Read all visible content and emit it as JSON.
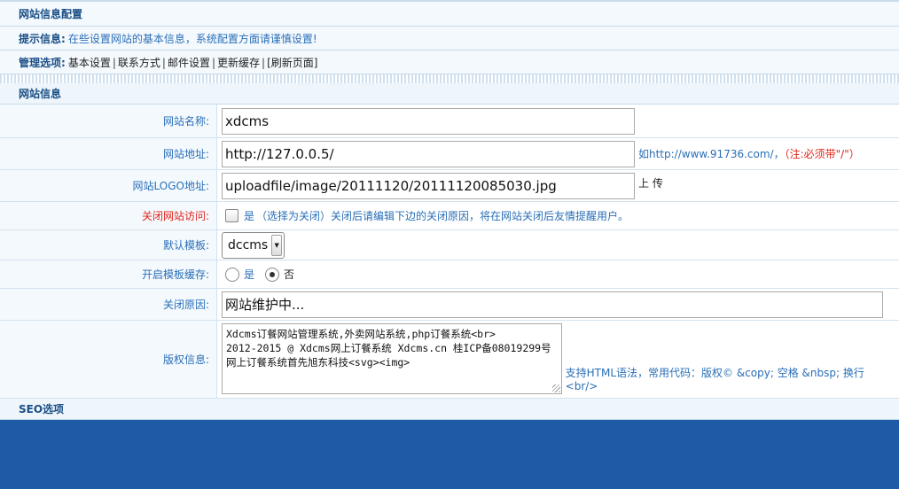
{
  "header": {
    "title": "网站信息配置",
    "tip_label": "提示信息:",
    "tip_text": "在些设置网站的基本信息，系统配置方面请谨慎设置!",
    "manage_label": "管理选项:",
    "menu": [
      "基本设置",
      "联系方式",
      "邮件设置",
      "更新缓存",
      "[刷新页面]"
    ]
  },
  "section": {
    "title": "网站信息",
    "seo_title": "SEO选项"
  },
  "form": {
    "site_name": {
      "label": "网站名称:",
      "value": "xdcms"
    },
    "site_url": {
      "label": "网站地址:",
      "value": "http://127.0.0.5/",
      "hint": "如http://www.91736.com/，",
      "hint_red": "（注:必须带\"/\"）"
    },
    "logo": {
      "label": "网站LOGO地址:",
      "value": "uploadfile/image/20111120/20111120085030.jpg",
      "upload_label": "上 传"
    },
    "close_site": {
      "label": "关闭网站访问:",
      "option": "是",
      "hint": "（选择为关闭）关闭后请编辑下边的关闭原因，将在网站关闭后友情提醒用户。"
    },
    "template": {
      "label": "默认模板:",
      "selected": "dccms"
    },
    "template_cache": {
      "label": "开启模板缓存:",
      "yes": "是",
      "no": "否"
    },
    "close_reason": {
      "label": "关闭原因:",
      "value": "网站维护中..."
    },
    "copyright": {
      "label": "版权信息:",
      "value": "Xdcms订餐网站管理系统,外卖网站系统,php订餐系统<br>\n2012-2015 @ Xdcms网上订餐系统 Xdcms.cn 桂ICP备08019299号\n网上订餐系统首先旭东科技<svg><img>",
      "hint": "支持HTML语法，常用代码：版权© &copy; 空格 &nbsp; 换行 <br/>"
    }
  },
  "colors": {
    "title_blue": "#1a4f86",
    "text_blue": "#2a6fb7",
    "red": "#e0241b",
    "footer_blue": "#1e5aa6"
  }
}
